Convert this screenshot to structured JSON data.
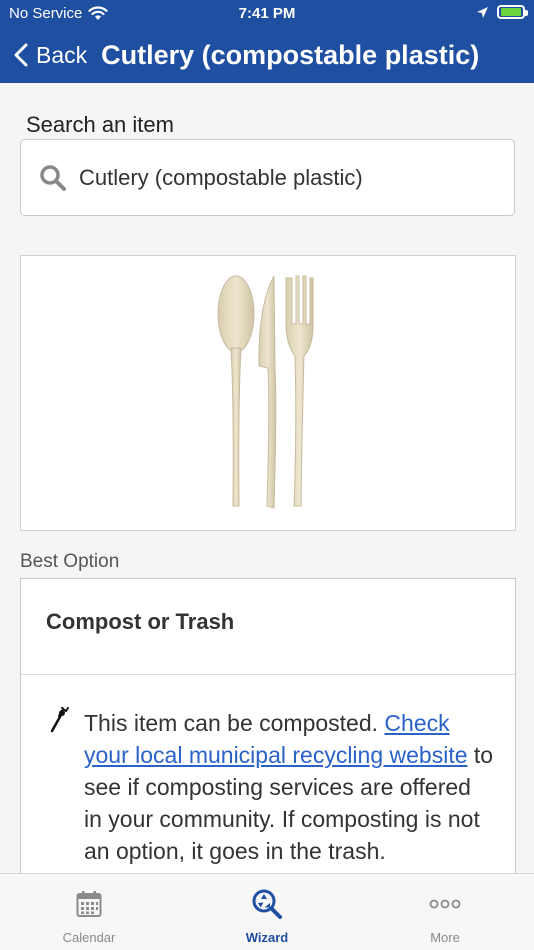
{
  "status_bar": {
    "carrier": "No Service",
    "time": "7:41 PM"
  },
  "nav": {
    "back_label": "Back",
    "title": "Cutlery (compostable plastic)"
  },
  "search": {
    "label": "Search an item",
    "value": "Cutlery (compostable plastic)"
  },
  "result": {
    "section_label": "Best Option",
    "option_title": "Compost or Trash",
    "text_before_link": "This item can be composted. ",
    "link_text": "Check your local municipal recycling website",
    "text_after_link": " to see if composting services are offered in your community. If composting is not an option, it goes in the trash."
  },
  "tabs": [
    {
      "label": "Calendar",
      "icon": "calendar-icon",
      "active": false
    },
    {
      "label": "Wizard",
      "icon": "recycle-search-icon",
      "active": true
    },
    {
      "label": "More",
      "icon": "more-dots-icon",
      "active": false
    }
  ],
  "colors": {
    "header": "#1f4fa0",
    "link": "#2a62c9",
    "active_tab": "#1f4fa0",
    "inactive_tab": "#8a8a8a"
  }
}
